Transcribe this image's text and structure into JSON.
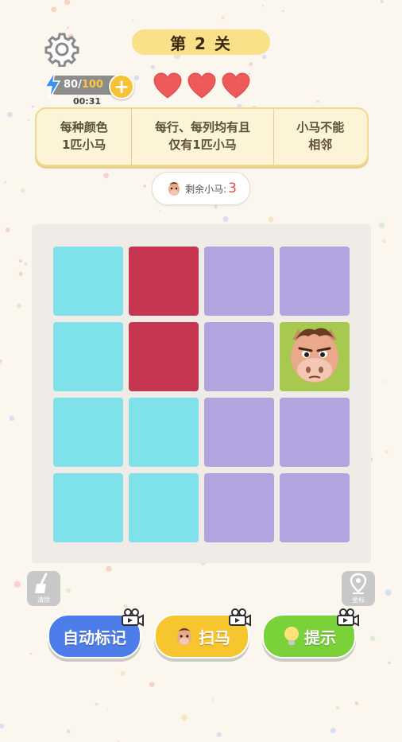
{
  "header": {
    "level_label": "第 2 关"
  },
  "energy": {
    "current": "80",
    "separator": "/",
    "max": "100",
    "timer": "00:31"
  },
  "lives": {
    "hearts": 3,
    "color": "#ee5a5a"
  },
  "rules": [
    "每种颜色\n1匹小马",
    "每行、每列均有且\n仅有1匹小马",
    "小马不能\n相邻"
  ],
  "remaining": {
    "label": "剩余小马:",
    "count": "3"
  },
  "board": {
    "rows": 4,
    "cols": 4,
    "colors": {
      "cyan": "#7fe1ea",
      "red": "#c73650",
      "purple": "#b3a3df",
      "green": "#a8c94f"
    },
    "cells": [
      [
        "cyan",
        "red",
        "purple",
        "purple"
      ],
      [
        "cyan",
        "red",
        "purple",
        "green"
      ],
      [
        "cyan",
        "cyan",
        "purple",
        "purple"
      ],
      [
        "cyan",
        "cyan",
        "purple",
        "purple"
      ]
    ],
    "horse": {
      "row": 1,
      "col": 3
    }
  },
  "tools": {
    "clear_label": "清除",
    "coord_label": "坐标"
  },
  "actions": {
    "auto_mark": "自动标记",
    "scan": "扫马",
    "hint": "提示"
  }
}
